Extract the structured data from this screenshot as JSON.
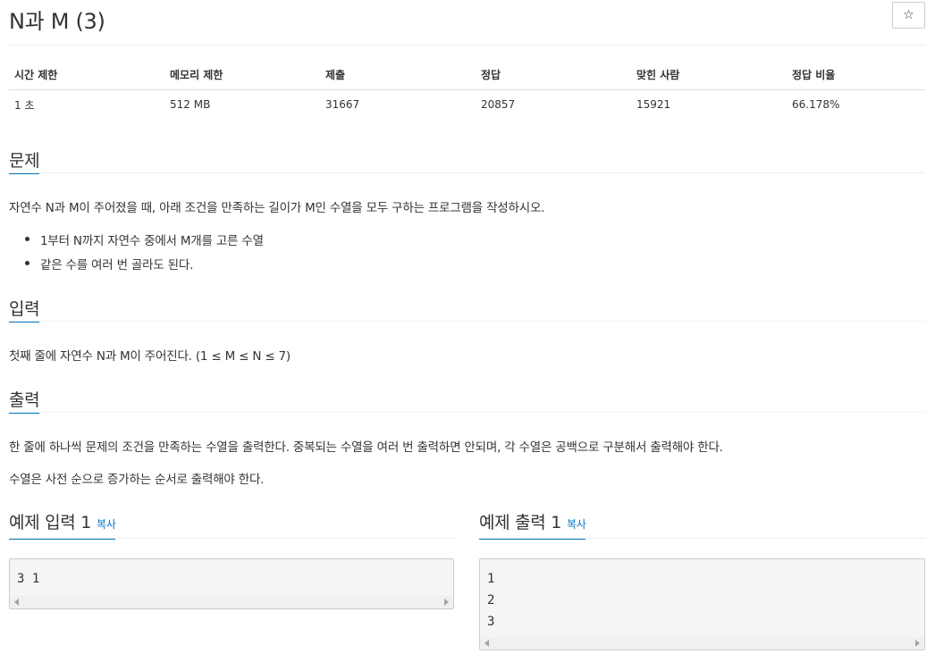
{
  "problem": {
    "title": "N과 M (3)",
    "star_icon": "☆"
  },
  "info_table": {
    "headers": [
      "시간 제한",
      "메모리 제한",
      "제출",
      "정답",
      "맞힌 사람",
      "정답 비율"
    ],
    "values": [
      "1 초",
      "512 MB",
      "31667",
      "20857",
      "15921",
      "66.178%"
    ]
  },
  "sections": {
    "description": {
      "heading": "문제",
      "text": "자연수 N과 M이 주어졌을 때, 아래 조건을 만족하는 길이가 M인 수열을 모두 구하는 프로그램을 작성하시오.",
      "bullets": [
        "1부터 N까지 자연수 중에서 M개를 고른 수열",
        "같은 수를 여러 번 골라도 된다."
      ]
    },
    "input": {
      "heading": "입력",
      "text": "첫째 줄에 자연수 N과 M이 주어진다. (1 ≤ M ≤ N ≤ 7)"
    },
    "output": {
      "heading": "출력",
      "text1": "한 줄에 하나씩 문제의 조건을 만족하는 수열을 출력한다. 중복되는 수열을 여러 번 출력하면 안되며, 각 수열은 공백으로 구분해서 출력해야 한다.",
      "text2": "수열은 사전 순으로 증가하는 순서로 출력해야 한다."
    }
  },
  "samples": {
    "input": {
      "heading": "예제 입력 1",
      "copy_label": "복사",
      "lines": [
        "3 1"
      ]
    },
    "output": {
      "heading": "예제 출력 1",
      "copy_label": "복사",
      "lines": [
        "1",
        "2",
        "3"
      ]
    }
  }
}
